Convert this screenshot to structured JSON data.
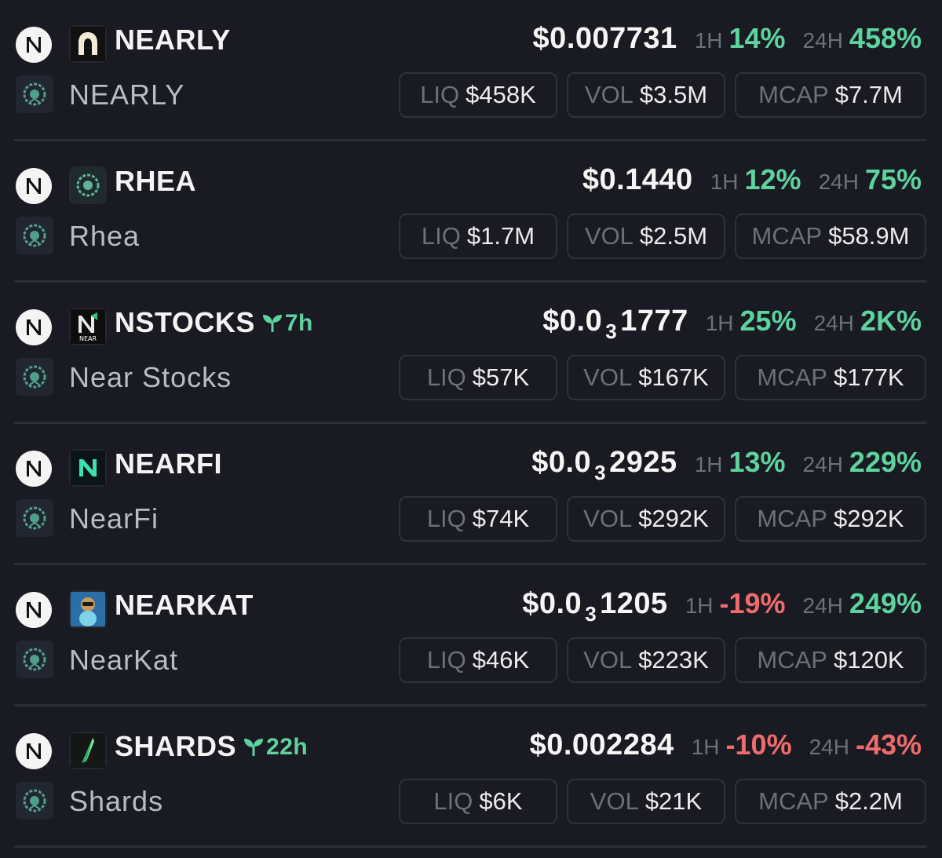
{
  "colors": {
    "background": "#191a22",
    "positive": "#5dd39e",
    "negative": "#f06b6b",
    "label": "#6d707a"
  },
  "labels": {
    "h1": "1H",
    "h24": "24H",
    "liq": "LIQ",
    "vol": "VOL",
    "mcap": "MCAP"
  },
  "tokens": [
    {
      "symbol": "NEARLY",
      "name": "NEARLY",
      "age": "",
      "logo": "arch-logo",
      "price_prefix": "$0.007731",
      "price_zeros": "",
      "price_digits": "",
      "h1": "14%",
      "h1_dir": "pos",
      "h24": "458%",
      "h24_dir": "pos",
      "liq": "$458K",
      "vol": "$3.5M",
      "mcap": "$7.7M"
    },
    {
      "symbol": "RHEA",
      "name": "Rhea",
      "age": "",
      "logo": "wreath-logo",
      "price_prefix": "$0.1440",
      "price_zeros": "",
      "price_digits": "",
      "h1": "12%",
      "h1_dir": "pos",
      "h24": "75%",
      "h24_dir": "pos",
      "liq": "$1.7M",
      "vol": "$2.5M",
      "mcap": "$58.9M"
    },
    {
      "symbol": "NSTOCKS",
      "name": "Near Stocks",
      "age": "7h",
      "logo": "near-stocks-logo",
      "price_prefix": "$0.0",
      "price_zeros": "3",
      "price_digits": "1777",
      "h1": "25%",
      "h1_dir": "pos",
      "h24": "2K%",
      "h24_dir": "pos",
      "liq": "$57K",
      "vol": "$167K",
      "mcap": "$177K"
    },
    {
      "symbol": "NEARFI",
      "name": "NearFi",
      "age": "",
      "logo": "nearfi-logo",
      "price_prefix": "$0.0",
      "price_zeros": "3",
      "price_digits": "2925",
      "h1": "13%",
      "h1_dir": "pos",
      "h24": "229%",
      "h24_dir": "pos",
      "liq": "$74K",
      "vol": "$292K",
      "mcap": "$292K"
    },
    {
      "symbol": "NEARKAT",
      "name": "NearKat",
      "age": "",
      "logo": "meerkat-logo",
      "price_prefix": "$0.0",
      "price_zeros": "3",
      "price_digits": "1205",
      "h1": "-19%",
      "h1_dir": "neg",
      "h24": "249%",
      "h24_dir": "pos",
      "liq": "$46K",
      "vol": "$223K",
      "mcap": "$120K"
    },
    {
      "symbol": "SHARDS",
      "name": "Shards",
      "age": "22h",
      "logo": "shard-logo",
      "price_prefix": "$0.002284",
      "price_zeros": "",
      "price_digits": "",
      "h1": "-10%",
      "h1_dir": "neg",
      "h24": "-43%",
      "h24_dir": "neg",
      "liq": "$6K",
      "vol": "$21K",
      "mcap": "$2.2M"
    }
  ]
}
